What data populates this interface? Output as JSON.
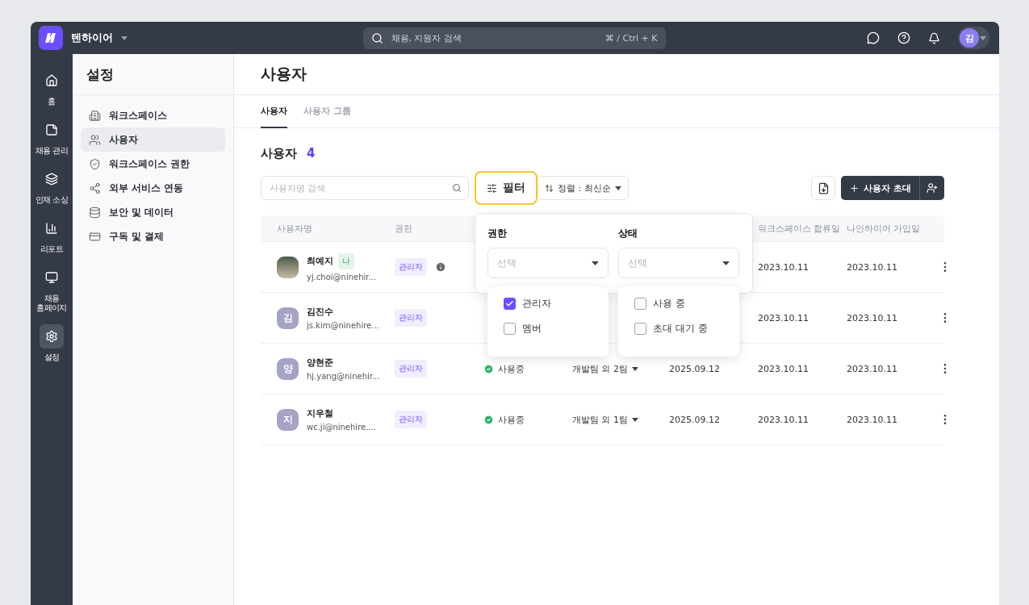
{
  "topbar": {
    "workspace": "텐하이어",
    "search_placeholder": "채용, 지원자 검색",
    "shortcut": "⌘ / Ctrl + K",
    "avatar": "김"
  },
  "rail": [
    {
      "label": "홈",
      "selected": false
    },
    {
      "label": "채용 관리",
      "selected": false
    },
    {
      "label": "인재 소싱",
      "selected": false
    },
    {
      "label": "리포트",
      "selected": false
    },
    {
      "label": "채용 홈페이지",
      "selected": false
    },
    {
      "label": "설정",
      "selected": true
    }
  ],
  "settings": {
    "title": "설정",
    "items": [
      {
        "label": "워크스페이스",
        "selected": false
      },
      {
        "label": "사용자",
        "selected": true
      },
      {
        "label": "워크스페이스 권한",
        "selected": false
      },
      {
        "label": "외부 서비스 연동",
        "selected": false
      },
      {
        "label": "보안 및 데이터",
        "selected": false
      },
      {
        "label": "구독 및 결제",
        "selected": false
      }
    ]
  },
  "page": {
    "title": "사용자",
    "tabs": [
      {
        "label": "사용자",
        "selected": true
      },
      {
        "label": "사용자 그룹",
        "selected": false
      }
    ],
    "section_title": "사용자",
    "count": "4",
    "search_placeholder": "사용자명 검색",
    "filter": {
      "label": "필터",
      "highlighted": true
    },
    "sort": "정렬 : 최신순",
    "invite": "사용자 초대"
  },
  "table": {
    "columns": [
      {
        "label": "사용자명"
      },
      {
        "label": "권한"
      },
      {},
      {},
      {},
      {
        "label": "워크스페이스 합류일"
      },
      {
        "label": "나인하이어 가입일"
      }
    ],
    "rows": [
      {
        "name": "최예지",
        "me_badge": "나",
        "email": "yj.choi@ninehir...",
        "avatar": {
          "kind": "photo"
        },
        "role": "관리자",
        "role_info": true,
        "joined": "2023.10.11",
        "signup": "2023.10.11"
      },
      {
        "name": "김진수",
        "email": "js.kim@ninehire...",
        "avatar": {
          "kind": "initial",
          "text": "김"
        },
        "role": "관리자",
        "role_info": false,
        "joined": "2023.10.11",
        "signup": "2023.10.11"
      },
      {
        "name": "양현준",
        "email": "hj.yang@ninehir...",
        "avatar": {
          "kind": "initial",
          "text": "양"
        },
        "role": "관리자",
        "role_info": false,
        "status": "사용중",
        "team": "개발팀 외 2팀",
        "date": "2025.09.12",
        "joined": "2023.10.11",
        "signup": "2023.10.11"
      },
      {
        "name": "지우철",
        "email": "wc.ji@ninehire....",
        "avatar": {
          "kind": "initial",
          "text": "지"
        },
        "role": "관리자",
        "role_info": false,
        "status": "사용중",
        "team": "개발팀 외 1팀",
        "date": "2025.09.12",
        "joined": "2023.10.11",
        "signup": "2023.10.11"
      }
    ]
  },
  "filter_popover": {
    "groups": [
      {
        "title": "권한",
        "placeholder": "선택",
        "options": [
          {
            "label": "관리자",
            "checked": true
          },
          {
            "label": "멤버",
            "checked": false
          }
        ]
      },
      {
        "title": "상태",
        "placeholder": "선택",
        "options": [
          {
            "label": "사용 중",
            "checked": false
          },
          {
            "label": "초대 대기 중",
            "checked": false
          }
        ]
      }
    ]
  }
}
